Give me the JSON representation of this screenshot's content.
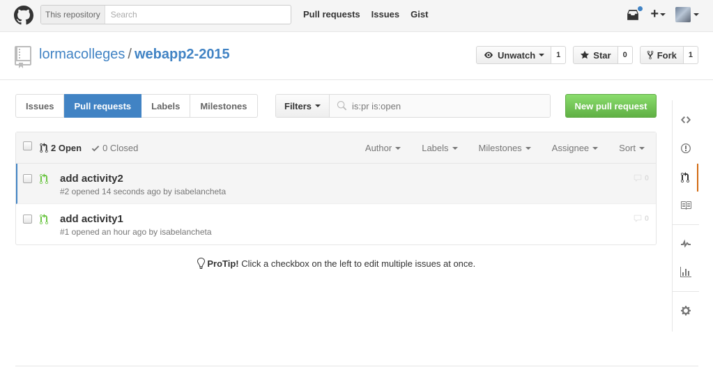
{
  "header": {
    "search_scope": "This repository",
    "search_placeholder": "Search",
    "nav": [
      "Pull requests",
      "Issues",
      "Gist"
    ]
  },
  "repo": {
    "owner": "lormacolleges",
    "separator": "/",
    "name": "webapp2-2015",
    "watch": {
      "label": "Unwatch",
      "count": "1"
    },
    "star": {
      "label": "Star",
      "count": "0"
    },
    "fork": {
      "label": "Fork",
      "count": "1"
    }
  },
  "subnav": {
    "items": [
      "Issues",
      "Pull requests",
      "Labels",
      "Milestones"
    ],
    "selected": "Pull requests"
  },
  "filters": {
    "label": "Filters",
    "query": "is:pr is:open"
  },
  "new_pr_label": "New pull request",
  "table": {
    "open_label": "2 Open",
    "closed_label": "0 Closed",
    "sorts": [
      "Author",
      "Labels",
      "Milestones",
      "Assignee",
      "Sort"
    ],
    "rows": [
      {
        "title": "add activity2",
        "meta": "#2 opened 14 seconds ago by isabelancheta",
        "comments": "0"
      },
      {
        "title": "add activity1",
        "meta": "#1 opened an hour ago by isabelancheta",
        "comments": "0"
      }
    ]
  },
  "protip": {
    "label": "ProTip!",
    "text": " Click a checkbox on the left to edit multiple issues at once."
  },
  "sidebar": {
    "icons": [
      "code-icon",
      "issue-opened-icon",
      "git-pull-request-icon",
      "book-icon",
      "pulse-icon",
      "graph-icon",
      "gear-icon"
    ],
    "selected": "git-pull-request-icon"
  },
  "colors": {
    "link": "#4183c4",
    "selected_tab": "#4183c4",
    "new_pr_green": "#60b044",
    "pr_icon_green": "#6cc644",
    "sidebar_selected": "#d26911"
  }
}
